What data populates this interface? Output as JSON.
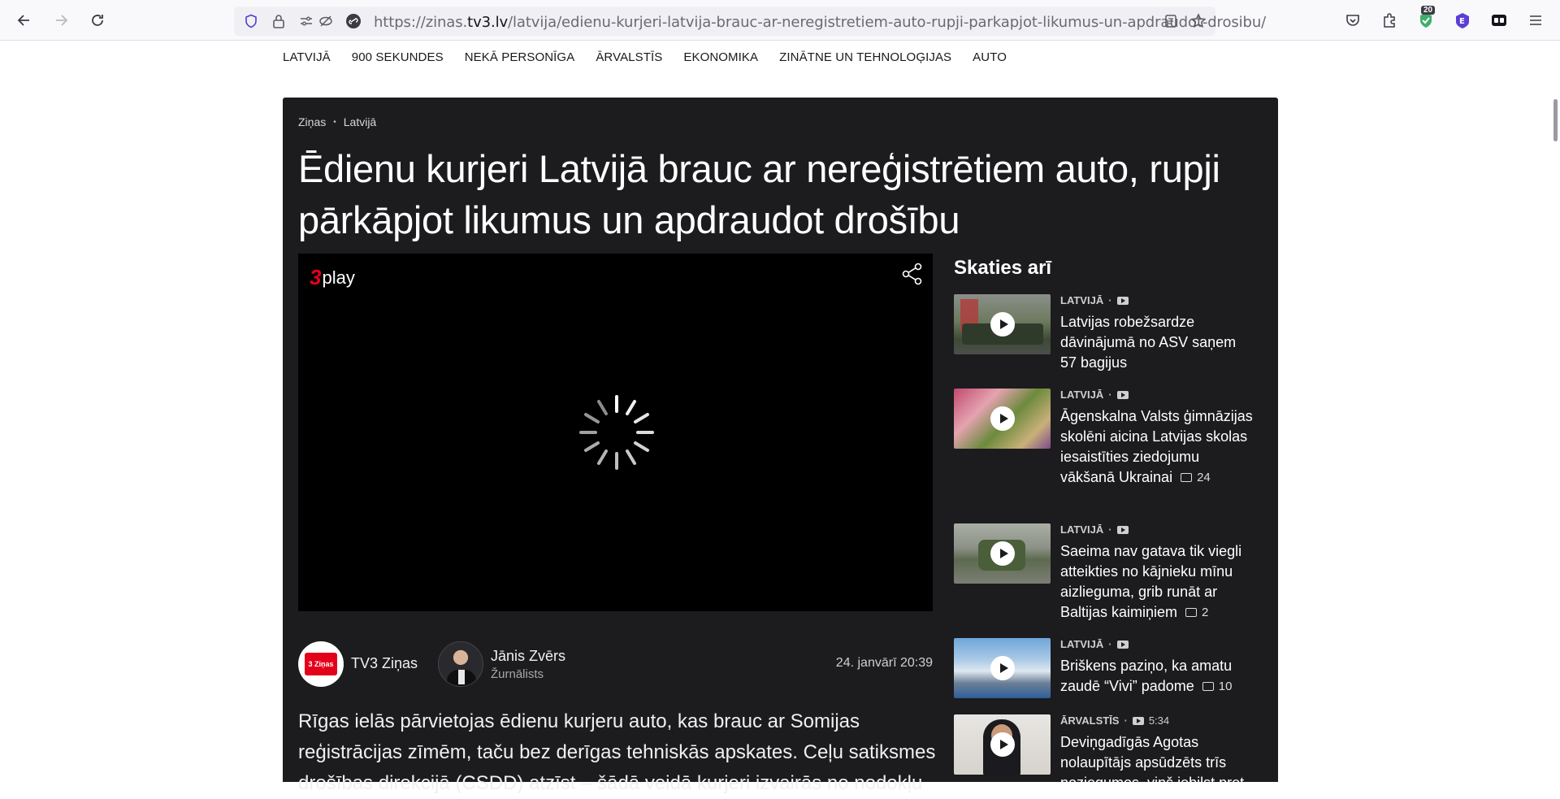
{
  "browser": {
    "url_prefix": "https://zinas.",
    "url_domain": "tv3.lv",
    "url_path": "/latvija/edienu-kurjeri-latvija-brauc-ar-neregistretiem-auto-rupji-parkapjot-likumus-un-apdraudot-drosibu/",
    "extension_badge": "20"
  },
  "categories": [
    "LATVIJĀ",
    "900 SEKUNDES",
    "NEKĀ PERSONĪGA",
    "ĀRVALSTĪS",
    "EKONOMIKA",
    "ZINĀTNE UN TEHNOLOĢIJAS",
    "AUTO"
  ],
  "breadcrumb": {
    "home": "Ziņas",
    "section": "Latvijā"
  },
  "article": {
    "headline": "Ēdienu kurjeri Latvijā brauc ar nereģistrētiem auto, rupji pārkāpjot likumus un apdraudot drošību",
    "player_logo": "play",
    "player_logo_mark": "3",
    "source_name": "TV3 Ziņas",
    "source_logo_text": "3 Ziņas",
    "author_name": "Jānis Zvērs",
    "author_role": "Žurnālists",
    "date": "24. janvārī 20:39",
    "lead": "Rīgas ielās pārvietojas ēdienu kurjeru auto, kas brauc ar Somijas reģistrācijas zīmēm, taču bez derīgas tehniskās apskates. Ceļu satiksmes drošības direkcijā (CSDD) atzīst – šādā veidā kurjeri izvairās no nodokļu"
  },
  "sidebar": {
    "title": "Skaties arī",
    "items": [
      {
        "category": "LATVIJĀ",
        "duration": "",
        "text": "Latvijas robežsardze dāvinājumā no ASV saņem 57 bagijus",
        "comments": ""
      },
      {
        "category": "LATVIJĀ",
        "duration": "",
        "text": "Āgenskalna Valsts ģimnāzijas skolēni aicina Latvijas skolas iesaistīties ziedojumu vākšanā Ukrainai",
        "comments": "24"
      },
      {
        "category": "LATVIJĀ",
        "duration": "",
        "text": "Saeima nav gatava tik viegli atteikties no kājnieku mīnu aizlieguma, grib runāt ar Baltijas kaimiņiem",
        "comments": "2"
      },
      {
        "category": "LATVIJĀ",
        "duration": "",
        "text": "Briškens paziņo, ka amatu zaudē “Vivi” padome",
        "comments": "10"
      },
      {
        "category": "ĀRVALSTĪS",
        "duration": "5:34",
        "text": "Deviņgadīgās Agotas nolaupītājs apsūdzēts trīs noziegumos, viņš iebilst pret",
        "comments": ""
      }
    ]
  }
}
